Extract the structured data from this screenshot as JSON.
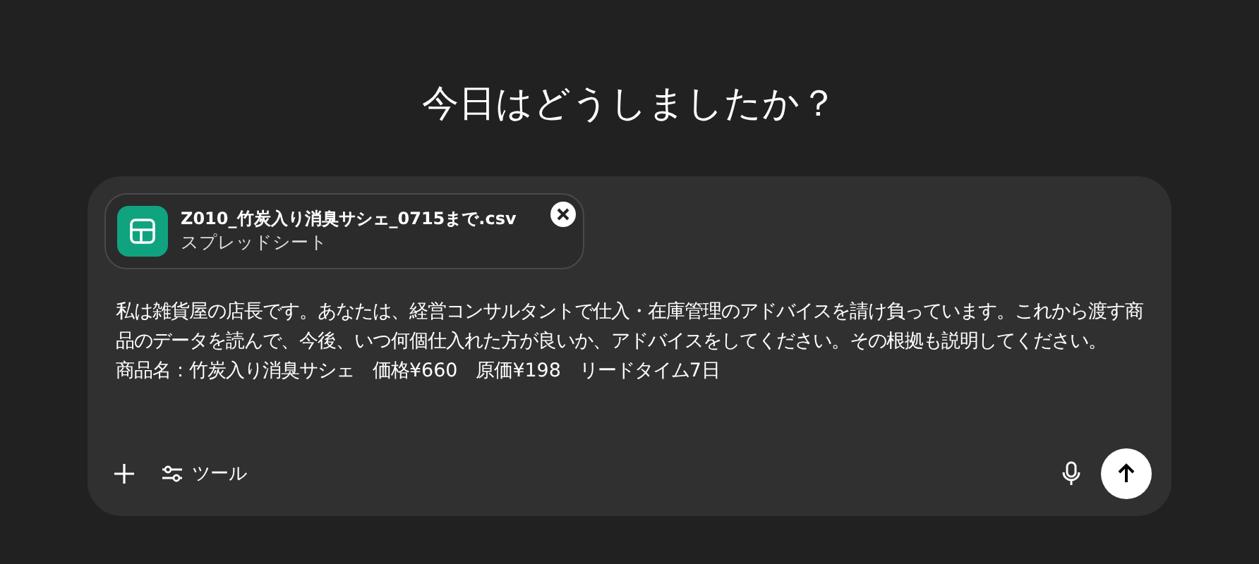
{
  "heading": "今日はどうしましたか？",
  "attachment": {
    "filename": "Z010_竹炭入り消臭サシェ_0715まで.csv",
    "type_label": "スプレッドシート"
  },
  "message": [
    "私は雑貨屋の店長です。あなたは、経営コンサルタントで仕入・在庫管理のアドバイスを請け負っています。これから渡す商品のデータを読んで、今後、いつ何個仕入れた方が良いか、アドバイスをしてください。その根拠も説明してください。",
    "商品名：竹炭入り消臭サシェ　価格¥660　原価¥198　リードタイム7日"
  ],
  "toolbar": {
    "tools_label": "ツール"
  }
}
